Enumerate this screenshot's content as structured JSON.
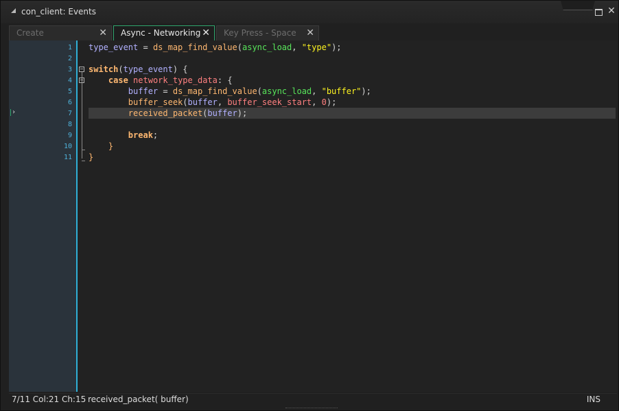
{
  "window": {
    "title": "con_client: Events"
  },
  "tabs": [
    {
      "label": "Create",
      "active": false
    },
    {
      "label": "Async - Networking",
      "active": true
    },
    {
      "label": "Key Press - Space",
      "active": false
    }
  ],
  "editor": {
    "line_numbers": [
      "1",
      "2",
      "3",
      "4",
      "5",
      "6",
      "7",
      "8",
      "9",
      "10",
      "11"
    ],
    "current_line": 7,
    "code": {
      "l1": {
        "a": "type_event",
        "b": " = ",
        "c": "ds_map_find_value",
        "d": "(",
        "e": "async_load",
        "f": ", ",
        "g": "\"type\"",
        "h": ");"
      },
      "l3": {
        "a": "switch",
        "b": "(",
        "c": "type_event",
        "d": ") {"
      },
      "l4": {
        "indent": "    ",
        "a": "case",
        "b": " ",
        "c": "network_type_data",
        "d": ": {"
      },
      "l5": {
        "indent": "        ",
        "a": "buffer",
        "b": " = ",
        "c": "ds_map_find_value",
        "d": "(",
        "e": "async_load",
        "f": ", ",
        "g": "\"buffer\"",
        "h": ");"
      },
      "l6": {
        "indent": "        ",
        "a": "buffer_seek",
        "b": "(",
        "c": "buffer",
        "d": ", ",
        "e": "buffer_seek_start",
        "f": ", ",
        "g": "0",
        "h": ");"
      },
      "l7": {
        "indent": "        ",
        "a": "received_packet",
        "b": "(",
        "c": "buffer",
        "d": ");"
      },
      "l9": {
        "indent": "        ",
        "a": "break",
        "b": ";"
      },
      "l10": {
        "indent": "    ",
        "a": "}"
      },
      "l11": {
        "a": "}"
      }
    }
  },
  "status": {
    "position": "7/11 Col:21 Ch:15",
    "signature": "received_packet( buffer)",
    "mode": "INS"
  },
  "colors": {
    "accent": "#2fa66d",
    "gutter_border": "#2fb0d7"
  }
}
